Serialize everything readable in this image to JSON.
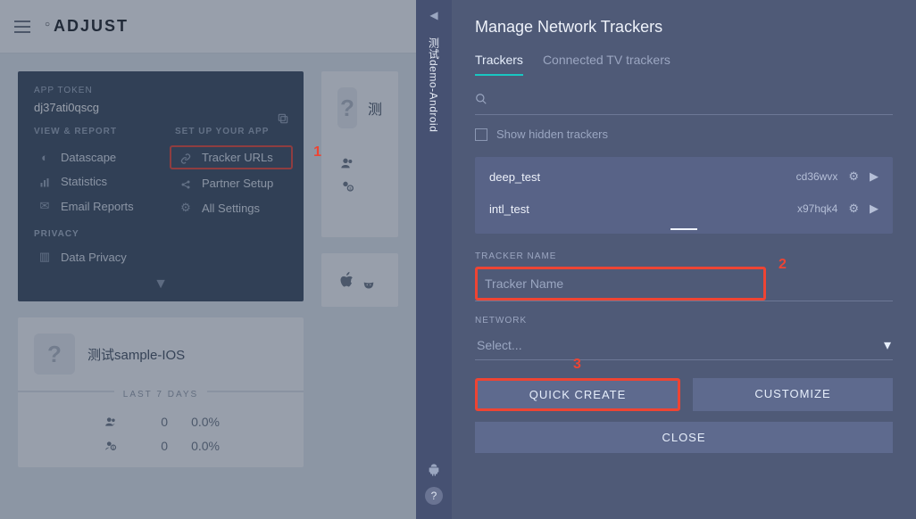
{
  "logo": "ADJUST",
  "annotations": {
    "a1": "1",
    "a2": "2",
    "a3": "3"
  },
  "panel": {
    "app_token_label": "APP TOKEN",
    "app_token_value": "dj37ati0qscg",
    "view_report_label": "VIEW & REPORT",
    "set_up_label": "SET UP YOUR APP",
    "view_items": [
      "Datascape",
      "Statistics",
      "Email Reports"
    ],
    "setup_items": [
      "Tracker URLs",
      "Partner Setup",
      "All Settings"
    ],
    "privacy_label": "PRIVACY",
    "privacy_item": "Data Privacy"
  },
  "cut_app_name": "测",
  "ios_app_name": "测试sample-IOS",
  "last7": "LAST 7 DAYS",
  "stat_zero": "0",
  "stat_pct": "0.0%",
  "rail_text": "测试demo-Android",
  "right": {
    "title": "Manage Network Trackers",
    "tabs": {
      "trackers": "Trackers",
      "ctv": "Connected TV trackers"
    },
    "show_hidden": "Show hidden trackers",
    "trackers": [
      {
        "name": "deep_test",
        "token": "cd36wvx"
      },
      {
        "name": "intl_test",
        "token": "x97hqk4"
      }
    ],
    "tracker_name_label": "TRACKER NAME",
    "tracker_name_placeholder": "Tracker Name",
    "network_label": "NETWORK",
    "network_select": "Select...",
    "quick_create": "QUICK CREATE",
    "customize": "CUSTOMIZE",
    "close": "CLOSE"
  }
}
